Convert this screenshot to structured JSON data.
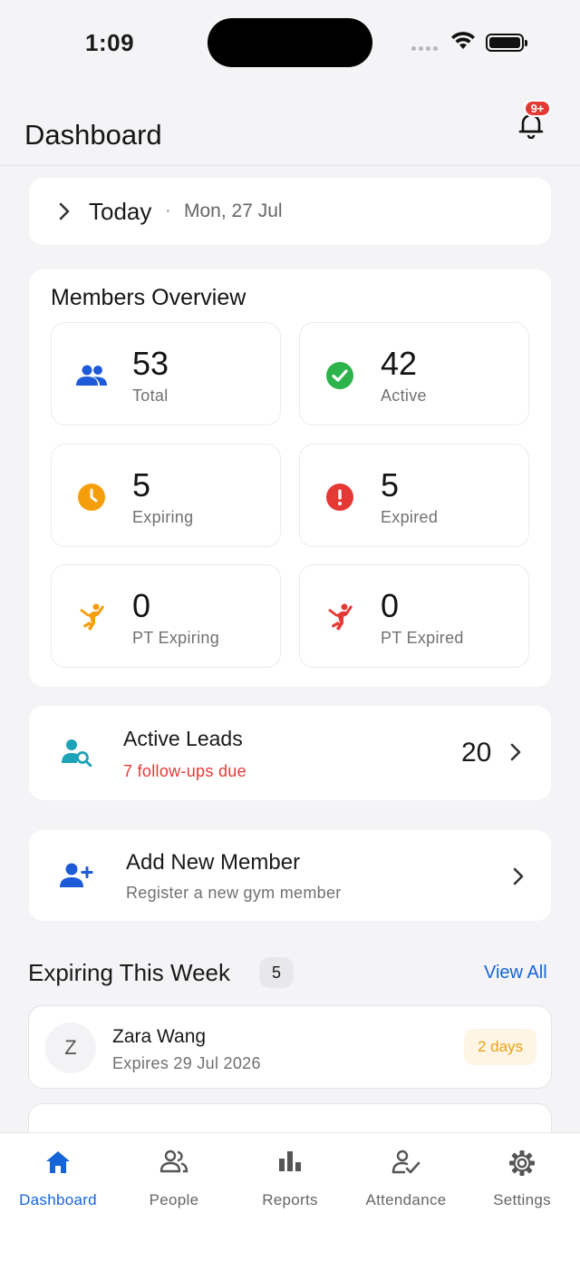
{
  "status": {
    "time": "1:09"
  },
  "header": {
    "title": "Dashboard",
    "notifications_badge": "9+"
  },
  "today": {
    "label": "Today",
    "separator": "·",
    "date": "Mon, 27 Jul"
  },
  "overview": {
    "title": "Members Overview",
    "stats": [
      {
        "value": "53",
        "label": "Total",
        "icon": "group-icon",
        "color": "#1e5bd8"
      },
      {
        "value": "42",
        "label": "Active",
        "icon": "check-circle-icon",
        "color": "#2cb34a"
      },
      {
        "value": "5",
        "label": "Expiring",
        "icon": "clock-icon",
        "color": "#f59e0b"
      },
      {
        "value": "5",
        "label": "Expired",
        "icon": "alert-circle-icon",
        "color": "#e53935"
      },
      {
        "value": "0",
        "label": "PT Expiring",
        "icon": "martial-arts-icon",
        "color": "#f59e0b"
      },
      {
        "value": "0",
        "label": "PT Expired",
        "icon": "martial-arts-icon",
        "color": "#e53935"
      }
    ]
  },
  "leads": {
    "title": "Active Leads",
    "subtitle": "7 follow-ups due",
    "count": "20"
  },
  "add_member": {
    "title": "Add New Member",
    "subtitle": "Register a new gym member"
  },
  "expiring": {
    "title": "Expiring This Week",
    "count": "5",
    "view_all": "View All",
    "members": [
      {
        "initial": "Z",
        "name": "Zara Wang",
        "expires": "Expires 29 Jul 2026",
        "days": "2 days"
      }
    ]
  },
  "tabs": [
    {
      "label": "Dashboard",
      "icon": "home-icon",
      "active": true
    },
    {
      "label": "People",
      "icon": "people-icon",
      "active": false
    },
    {
      "label": "Reports",
      "icon": "bar-chart-icon",
      "active": false
    },
    {
      "label": "Attendance",
      "icon": "person-check-icon",
      "active": false
    },
    {
      "label": "Settings",
      "icon": "gear-icon",
      "active": false
    }
  ],
  "colors": {
    "accent": "#1565d8",
    "danger": "#e53935",
    "warning": "#e8a317",
    "success": "#2cb34a"
  }
}
